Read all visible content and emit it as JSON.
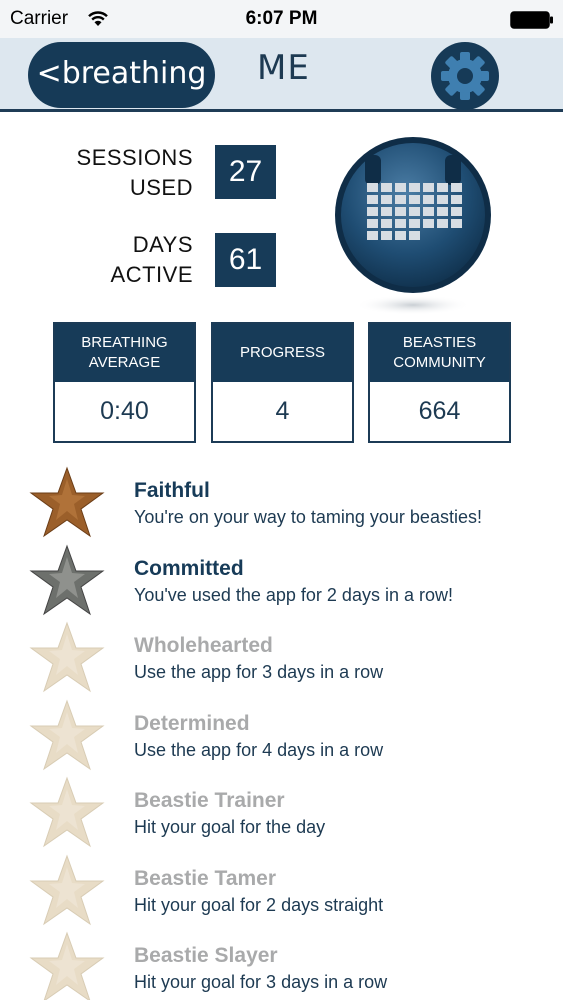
{
  "status": {
    "carrier": "Carrier",
    "time": "6:07 PM"
  },
  "nav": {
    "back_label": "<breathing",
    "title": "ME"
  },
  "stats": {
    "sessions_label_1": "SESSIONS",
    "sessions_label_2": "USED",
    "sessions_value": "27",
    "days_label_1": "DAYS",
    "days_label_2": "ACTIVE",
    "days_value": "61"
  },
  "cards": [
    {
      "head_1": "BREATHING",
      "head_2": "AVERAGE",
      "value": "0:40"
    },
    {
      "head_1": "PROGRESS",
      "head_2": "",
      "value": "4"
    },
    {
      "head_1": "BEASTIES",
      "head_2": "COMMUNITY",
      "value": "664"
    }
  ],
  "achievements": [
    {
      "title": "Faithful",
      "description": "You're on your way to taming your beasties!",
      "earned": true,
      "icon": "bronze-star-icon"
    },
    {
      "title": "Committed",
      "description": "You've used the app for 2 days in a row!",
      "earned": true,
      "icon": "silver-star-icon"
    },
    {
      "title": "Wholehearted",
      "description": "Use the app for 3 days in a row",
      "earned": false,
      "icon": "faded-star-icon"
    },
    {
      "title": "Determined",
      "description": "Use the app for 4 days in a row",
      "earned": false,
      "icon": "faded-star-icon"
    },
    {
      "title": "Beastie Trainer",
      "description": "Hit your goal for the day",
      "earned": false,
      "icon": "faded-star-icon"
    },
    {
      "title": "Beastie Tamer",
      "description": "Hit your goal for 2 days straight",
      "earned": false,
      "icon": "faded-star-icon"
    },
    {
      "title": "Beastie Slayer",
      "description": "Hit your goal for 3 days in a row",
      "earned": false,
      "icon": "faded-star-icon"
    }
  ],
  "colors": {
    "navy": "#173b58",
    "nav_bg": "#dde7ef",
    "locked_text": "#a9aaab",
    "bronze": "#9b5f2a",
    "silver": "#6d706c"
  }
}
